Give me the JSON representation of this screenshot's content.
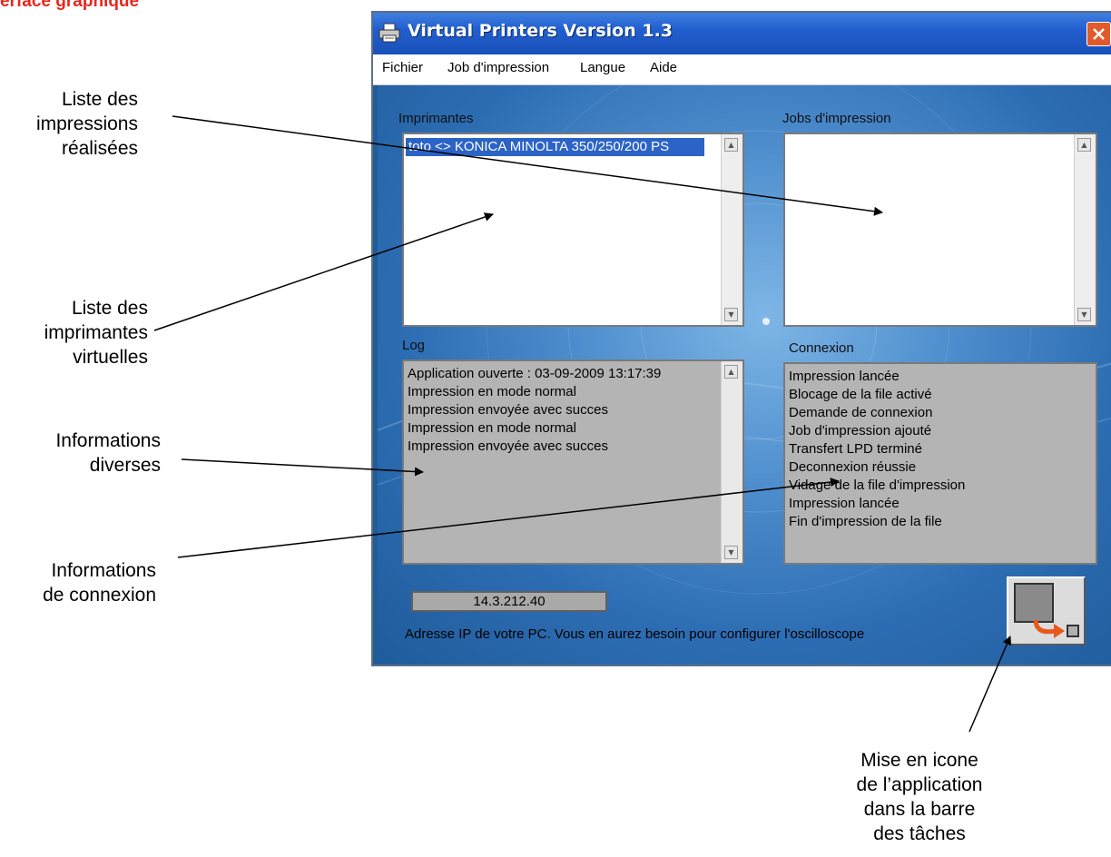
{
  "heading": "erface graphique",
  "annotations": {
    "impressions": [
      "Liste   des",
      "impressions",
      "réalisées"
    ],
    "imprimantes": [
      "Liste des",
      "imprimantes",
      "virtuelles"
    ],
    "informations": [
      "Informations",
      "diverses"
    ],
    "connexion": [
      "Informations",
      "de connexion"
    ],
    "icone": [
      "Mise en icone",
      "de l’application",
      "dans la barre",
      "des tâches"
    ]
  },
  "window": {
    "title": "Virtual Printers Version 1.3",
    "menu": [
      "Fichier",
      "Job d'impression",
      "Langue",
      "Aide"
    ]
  },
  "panels": {
    "printers": {
      "label": "Imprimantes",
      "items": [
        "toto <> KONICA MINOLTA 350/250/200 PS"
      ]
    },
    "jobs": {
      "label": "Jobs d'impression",
      "items": []
    },
    "log": {
      "label": "Log",
      "lines": [
        "Application ouverte : 03-09-2009  13:17:39",
        "Impression en mode normal",
        "Impression envoyée avec succes",
        "Impression en mode normal",
        "Impression envoyée avec succes"
      ]
    },
    "connexion": {
      "label": "Connexion",
      "lines": [
        "Impression lancée",
        "Blocage de la file activé",
        "Demande de connexion",
        "Job d'impression ajouté",
        "Transfert LPD terminé",
        "Deconnexion réussie",
        "Vidage de la file d'impression",
        "Impression lancée",
        "Fin d'impression de la file"
      ]
    }
  },
  "ip": {
    "value": "14.3.212.40",
    "help": "Adresse IP de votre PC. Vous en aurez besoin pour configurer l'oscilloscope"
  },
  "colors": {
    "heading": "#e8261c",
    "titlebar": "#215fcf",
    "client": "#2d6db3",
    "selection": "#2b63c6",
    "minimize_arrow": "#e8581c"
  },
  "icons": [
    "printer-icon",
    "close-icon",
    "scroll-up-icon",
    "scroll-down-icon",
    "minimize-to-tray-icon"
  ]
}
